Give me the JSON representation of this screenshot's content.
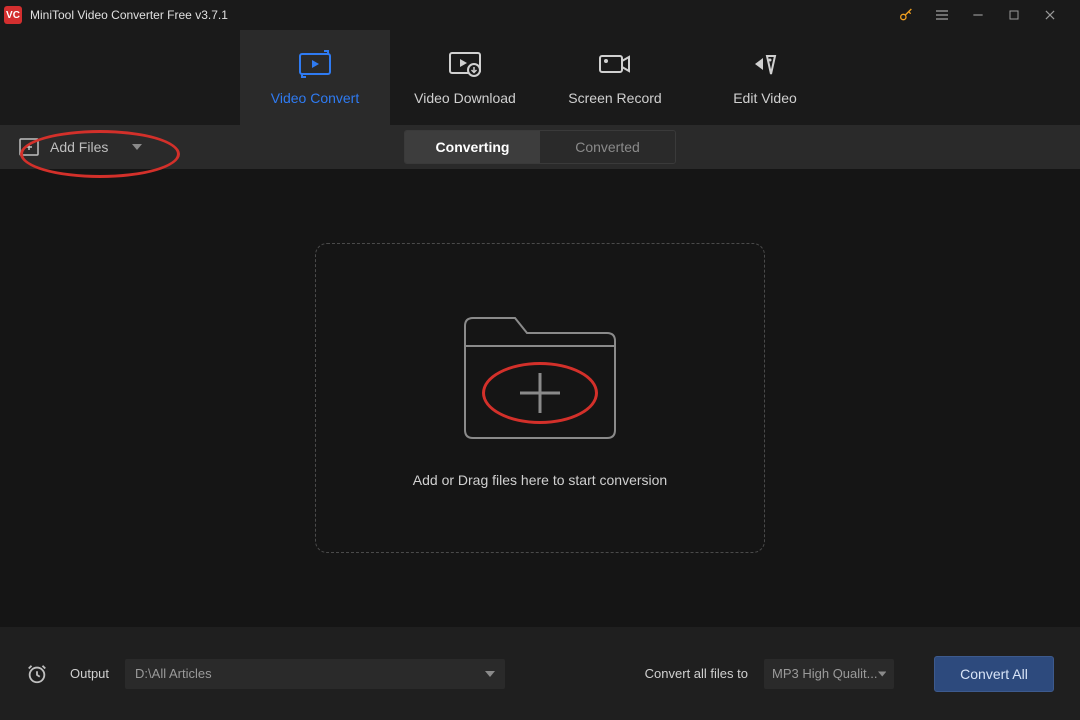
{
  "titlebar": {
    "app_title": "MiniTool Video Converter Free v3.7.1"
  },
  "tabs": {
    "video_convert": "Video Convert",
    "video_download": "Video Download",
    "screen_record": "Screen Record",
    "edit_video": "Edit Video"
  },
  "toolbar": {
    "add_files": "Add Files"
  },
  "subtabs": {
    "converting": "Converting",
    "converted": "Converted"
  },
  "dropzone": {
    "hint": "Add or Drag files here to start conversion"
  },
  "footer": {
    "output_label": "Output",
    "output_path": "D:\\All Articles",
    "convert_all_label": "Convert all files to",
    "format_selected": "MP3 High Qualit...",
    "convert_all_button": "Convert All"
  },
  "colors": {
    "accent": "#2f7bf2",
    "annotation": "#d3302a",
    "bg_dark": "#1a1a1a",
    "bg_darker": "#151515",
    "bg_panel": "#2a2a2a"
  }
}
